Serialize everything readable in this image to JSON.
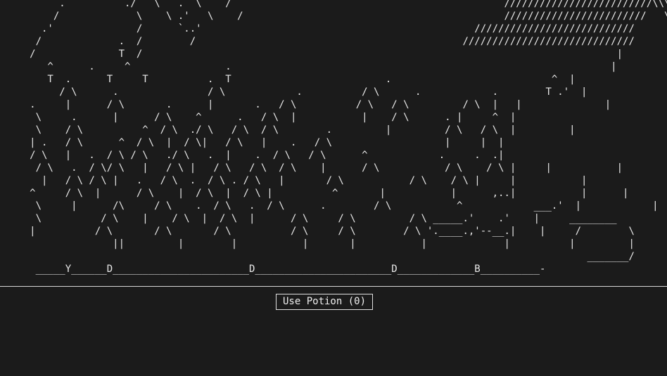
{
  "scene": {
    "lines": [
      "          .          ./   \\   .  \\    /                                              /////////////////////////\\\\\\\\\\\\\\\\\\\\",
      "         /             \\    \\ .'   \\    /                                            ////////////////////////   \\\\\\\\\\\\\\\\\\\\",
      "       .'              /      `..'                                              ///////////////////////////      \\\\\\\\\\\\\\",
      "      /             .  /        /                                             /////////////////////////////        \\\\\\\\\\",
      "     /              T  /                                                                                |          |         |",
      "        ^      .     ^                .                                                                |          |         |",
      "        T  .      T     T          .  T                          .                           ^  |                           |",
      "          / \\      .               / \\            .          / \\      .            .        T .'  |              |        |",
      "     .     |      / \\       .      |       .   / \\          / \\   / \\         / \\  |   |              |",
      "      \\     .      |      / \\    ^      .   / \\  |           |    / \\      . |     ^  |",
      "      \\    / \\          ^  / \\  ./ \\   / \\  / \\        .         |         / \\   / \\  |         |",
      "     | .   / \\      ^  / \\  |  / \\|   / \\   |    .   / \\                   |     |  |",
      "     / \\   |   .  / \\ / \\   ./ \\   .  |    .  / \\   / \\      ^            .     .  .|",
      "      / \\   .  / \\/ \\   |   / \\ |   / \\   / \\  / \\    |      / \\           / \\    / \\ |     |           |",
      "       |   / \\ / \\ |   .   / \\  .  / \\ . / \\   |       / \\           / \\    / \\ |     |           |",
      "     ^     / \\  |      / \\    |  / \\  |  / \\ |          ^       |           |      ,..|           |      |",
      "      \\     |      /\\     / \\    .  / \\   .  / \\      .        / \\           ^            ___.'  |            |",
      "      \\          / \\    |    / \\  |  / \\  |      / \\     / \\         / \\ _____.'    .'    |     ________",
      "     |          / \\       / \\       / \\          / \\     / \\        / \\ '.____.,'--__.|    |     /        \\",
      "                   ||         |        |           |       |           |             |          |         |",
      "                                                                                                   _______/",
      "      _____Y______D_______________________D_______________________D_____________B__________-",
      "     ______________________________________________________________________________________________________________________"
    ]
  },
  "controls": {
    "potion_label": "Use Potion (0)"
  }
}
